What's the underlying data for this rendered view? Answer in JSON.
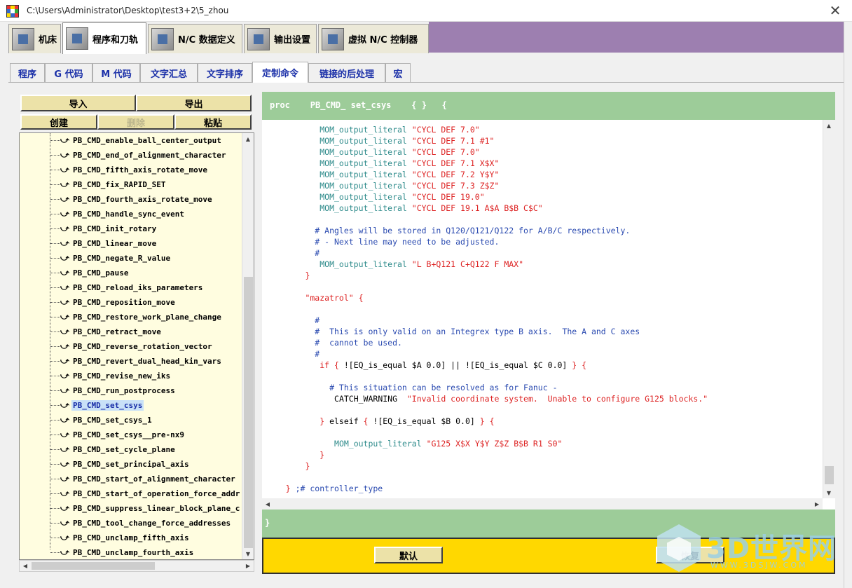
{
  "window": {
    "title": "C:\\Users\\Administrator\\Desktop\\test3+2\\5_zhou",
    "close_glyph": "✕"
  },
  "main_tabs": [
    {
      "label": "机床"
    },
    {
      "label": "程序和刀轨"
    },
    {
      "label": "N/C 数据定义"
    },
    {
      "label": "输出设置"
    },
    {
      "label": "虚拟 N/C 控制器"
    }
  ],
  "sub_tabs": [
    {
      "label": "程序"
    },
    {
      "label": "G 代码"
    },
    {
      "label": "M 代码"
    },
    {
      "label": "文字汇总"
    },
    {
      "label": "文字排序"
    },
    {
      "label": "定制命令"
    },
    {
      "label": "链接的后处理"
    },
    {
      "label": "宏"
    }
  ],
  "left": {
    "import_label": "导入",
    "export_label": "导出",
    "create_label": "创建",
    "delete_label": "删除",
    "paste_label": "粘贴",
    "tree_items": [
      "PB_CMD_enable_ball_center_output",
      "PB_CMD_end_of_alignment_character",
      "PB_CMD_fifth_axis_rotate_move",
      "PB_CMD_fix_RAPID_SET",
      "PB_CMD_fourth_axis_rotate_move",
      "PB_CMD_handle_sync_event",
      "PB_CMD_init_rotary",
      "PB_CMD_linear_move",
      "PB_CMD_negate_R_value",
      "PB_CMD_pause",
      "PB_CMD_reload_iks_parameters",
      "PB_CMD_reposition_move",
      "PB_CMD_restore_work_plane_change",
      "PB_CMD_retract_move",
      "PB_CMD_reverse_rotation_vector",
      "PB_CMD_revert_dual_head_kin_vars",
      "PB_CMD_revise_new_iks",
      "PB_CMD_run_postprocess",
      "PB_CMD_set_csys",
      "PB_CMD_set_csys_1",
      "PB_CMD_set_csys__pre-nx9",
      "PB_CMD_set_cycle_plane",
      "PB_CMD_set_principal_axis",
      "PB_CMD_start_of_alignment_character",
      "PB_CMD_start_of_operation_force_addr",
      "PB_CMD_suppress_linear_block_plane_c",
      "PB_CMD_tool_change_force_addresses",
      "PB_CMD_unclamp_fifth_axis",
      "PB_CMD_unclamp_fourth_axis"
    ],
    "selected_item": "PB_CMD_set_csys"
  },
  "editor": {
    "header": "proc    PB_CMD_ set_csys    { }   {",
    "closing": "}",
    "lines": [
      {
        "indent": 11,
        "parts": [
          [
            "fn",
            "MOM_output_literal "
          ],
          [
            "str",
            "\"CYCL DEF 7.0\""
          ]
        ]
      },
      {
        "indent": 11,
        "parts": [
          [
            "fn",
            "MOM_output_literal "
          ],
          [
            "str",
            "\"CYCL DEF 7.1 #1\""
          ]
        ]
      },
      {
        "indent": 11,
        "parts": [
          [
            "fn",
            "MOM_output_literal "
          ],
          [
            "str",
            "\"CYCL DEF 7.0\""
          ]
        ]
      },
      {
        "indent": 11,
        "parts": [
          [
            "fn",
            "MOM_output_literal "
          ],
          [
            "str",
            "\"CYCL DEF 7.1 X$X\""
          ]
        ]
      },
      {
        "indent": 11,
        "parts": [
          [
            "fn",
            "MOM_output_literal "
          ],
          [
            "str",
            "\"CYCL DEF 7.2 Y$Y\""
          ]
        ]
      },
      {
        "indent": 11,
        "parts": [
          [
            "fn",
            "MOM_output_literal "
          ],
          [
            "str",
            "\"CYCL DEF 7.3 Z$Z\""
          ]
        ]
      },
      {
        "indent": 11,
        "parts": [
          [
            "fn",
            "MOM_output_literal "
          ],
          [
            "str",
            "\"CYCL DEF 19.0\""
          ]
        ]
      },
      {
        "indent": 11,
        "parts": [
          [
            "fn",
            "MOM_output_literal "
          ],
          [
            "str",
            "\"CYCL DEF 19.1 A$A B$B C$C\""
          ]
        ]
      },
      {
        "indent": 0,
        "parts": []
      },
      {
        "indent": 10,
        "parts": [
          [
            "cm",
            "# Angles will be stored in Q120/Q121/Q122 for A/B/C respectively."
          ]
        ]
      },
      {
        "indent": 10,
        "parts": [
          [
            "cm",
            "# - Next line may need to be adjusted."
          ]
        ]
      },
      {
        "indent": 10,
        "parts": [
          [
            "cm",
            "#"
          ]
        ]
      },
      {
        "indent": 11,
        "parts": [
          [
            "fn",
            "MOM_output_literal "
          ],
          [
            "str",
            "\"L B+Q121 C+Q122 F MAX\""
          ]
        ]
      },
      {
        "indent": 8,
        "parts": [
          [
            "br",
            "}"
          ]
        ]
      },
      {
        "indent": 0,
        "parts": []
      },
      {
        "indent": 8,
        "parts": [
          [
            "str",
            "\"mazatrol\""
          ],
          [
            "br",
            " {"
          ]
        ]
      },
      {
        "indent": 0,
        "parts": []
      },
      {
        "indent": 10,
        "parts": [
          [
            "cm",
            "#"
          ]
        ]
      },
      {
        "indent": 10,
        "parts": [
          [
            "cm",
            "#  This is only valid on an Integrex type B axis.  The A and C axes"
          ]
        ]
      },
      {
        "indent": 10,
        "parts": [
          [
            "cm",
            "#  cannot be used."
          ]
        ]
      },
      {
        "indent": 10,
        "parts": [
          [
            "cm",
            "#"
          ]
        ]
      },
      {
        "indent": 11,
        "parts": [
          [
            "br",
            "if "
          ],
          [
            "br",
            "{ "
          ],
          [
            "kw",
            "![EQ_is_equal $A 0.0] || ![EQ_is_equal $C 0.0] "
          ],
          [
            "br",
            "} {"
          ]
        ]
      },
      {
        "indent": 0,
        "parts": []
      },
      {
        "indent": 13,
        "parts": [
          [
            "cm",
            "# This situation can be resolved as for Fanuc -"
          ]
        ]
      },
      {
        "indent": 14,
        "parts": [
          [
            "kw",
            "CATCH_WARNING  "
          ],
          [
            "str",
            "\"Invalid coordinate system.  Unable to configure G125 blocks.\""
          ]
        ]
      },
      {
        "indent": 0,
        "parts": []
      },
      {
        "indent": 11,
        "parts": [
          [
            "br",
            "} "
          ],
          [
            "kw",
            "elseif "
          ],
          [
            "br",
            "{ "
          ],
          [
            "kw",
            "![EQ_is_equal $B 0.0] "
          ],
          [
            "br",
            "} {"
          ]
        ]
      },
      {
        "indent": 0,
        "parts": []
      },
      {
        "indent": 14,
        "parts": [
          [
            "fn",
            "MOM_output_literal "
          ],
          [
            "str",
            "\"G125 X$X Y$Y Z$Z B$B R1 S0\""
          ]
        ]
      },
      {
        "indent": 11,
        "parts": [
          [
            "br",
            "}"
          ]
        ]
      },
      {
        "indent": 8,
        "parts": [
          [
            "br",
            "}"
          ]
        ]
      },
      {
        "indent": 0,
        "parts": []
      },
      {
        "indent": 4,
        "parts": [
          [
            "br",
            "} "
          ],
          [
            "cm",
            ";# controller_type"
          ]
        ]
      }
    ]
  },
  "bottom": {
    "default_label": "默认",
    "restore_label": "恢复"
  },
  "watermark": {
    "big": "3D世界网",
    "small": "WWW.3DSJW.COM"
  },
  "colors": {
    "green_bar": "#9dcc99",
    "yellow_bar": "#ffd800",
    "tree_bg": "#fffde0",
    "purple": "#9d7fb0",
    "accent_blue": "#1a2fa8"
  }
}
